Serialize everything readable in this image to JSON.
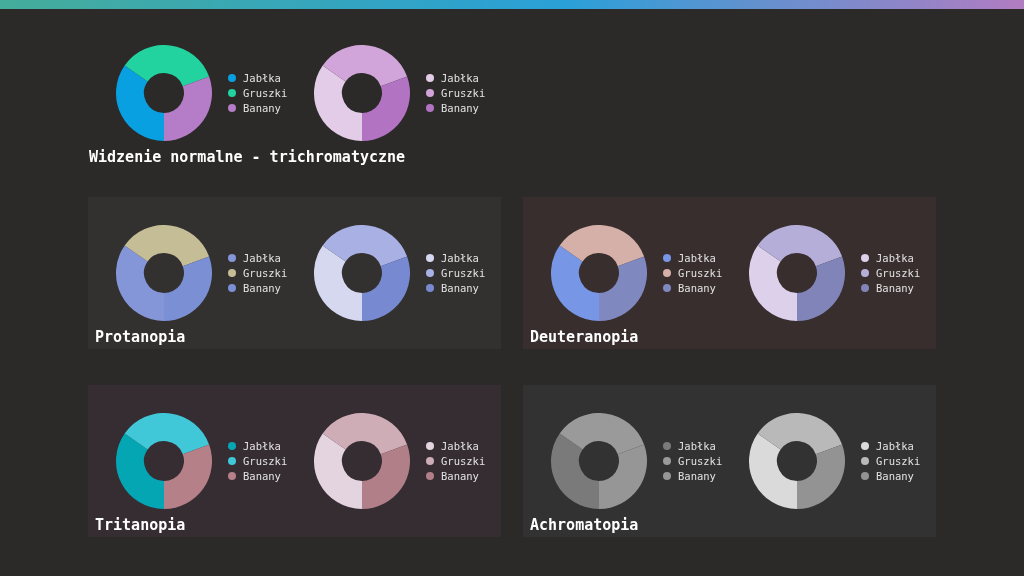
{
  "sections": [
    {
      "title": "Widzenie normalne - trichromatyczne",
      "kind": "plain",
      "charts": [
        {
          "legend": [
            {
              "label": "Jabłka",
              "color": "#08a0e0"
            },
            {
              "label": "Gruszki",
              "color": "#22d3a0"
            },
            {
              "label": "Banany",
              "color": "#b57cc8"
            }
          ]
        },
        {
          "legend": [
            {
              "label": "Jabłka",
              "color": "#e3cce8"
            },
            {
              "label": "Gruszki",
              "color": "#d1a5d9"
            },
            {
              "label": "Banany",
              "color": "#b173c2"
            }
          ]
        }
      ]
    },
    {
      "title": "Protanopia",
      "kind": "panel",
      "charts": [
        {
          "legend": [
            {
              "label": "Jabłka",
              "color": "#8495d8"
            },
            {
              "label": "Gruszki",
              "color": "#c5bd96"
            },
            {
              "label": "Banany",
              "color": "#7b8fd4"
            }
          ]
        },
        {
          "legend": [
            {
              "label": "Jabłka",
              "color": "#d6d8f0"
            },
            {
              "label": "Gruszki",
              "color": "#a8b0e4"
            },
            {
              "label": "Banany",
              "color": "#7789d0"
            }
          ]
        }
      ]
    },
    {
      "title": "Deuteranopia",
      "kind": "panel",
      "charts": [
        {
          "legend": [
            {
              "label": "Jabłka",
              "color": "#7896e6"
            },
            {
              "label": "Gruszki",
              "color": "#d4b0a8"
            },
            {
              "label": "Banany",
              "color": "#8088c0"
            }
          ]
        },
        {
          "legend": [
            {
              "label": "Jabłka",
              "color": "#ddd0ea"
            },
            {
              "label": "Gruszki",
              "color": "#b4aed8"
            },
            {
              "label": "Banany",
              "color": "#8084b8"
            }
          ]
        }
      ]
    },
    {
      "title": "Tritanopia",
      "kind": "panel",
      "charts": [
        {
          "legend": [
            {
              "label": "Jabłka",
              "color": "#05a6b4"
            },
            {
              "label": "Gruszki",
              "color": "#40c8d8"
            },
            {
              "label": "Banany",
              "color": "#b58088"
            }
          ]
        },
        {
          "legend": [
            {
              "label": "Jabłka",
              "color": "#e4d4e0"
            },
            {
              "label": "Gruszki",
              "color": "#cfadb7"
            },
            {
              "label": "Banany",
              "color": "#b07f88"
            }
          ]
        }
      ]
    },
    {
      "title": "Achromatopia",
      "kind": "panel",
      "charts": [
        {
          "legend": [
            {
              "label": "Jabłka",
              "color": "#7a7a7a"
            },
            {
              "label": "Gruszki",
              "color": "#9a9a9a"
            },
            {
              "label": "Banany",
              "color": "#969696"
            }
          ]
        },
        {
          "legend": [
            {
              "label": "Jabłka",
              "color": "#dadada"
            },
            {
              "label": "Gruszki",
              "color": "#b9b9b9"
            },
            {
              "label": "Banany",
              "color": "#939393"
            }
          ]
        }
      ]
    }
  ]
}
